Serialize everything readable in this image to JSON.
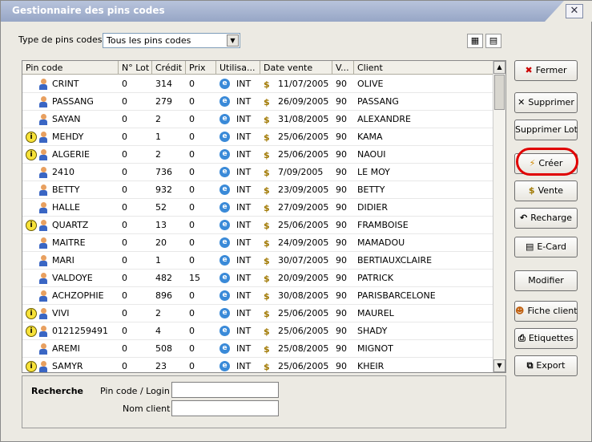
{
  "window": {
    "title": "Gestionnaire des pins codes",
    "close": "✕"
  },
  "filter": {
    "label": "Type de pins codes",
    "selected": "Tous les pins codes"
  },
  "grid": {
    "columns": [
      "Pin code",
      "N° Lot",
      "Crédit",
      "Prix",
      "Utilisa...",
      "Date vente",
      "V...",
      "Client"
    ],
    "rows": [
      {
        "info": false,
        "pin": "CRINT",
        "lot": "0",
        "credit": "314",
        "prix": "0",
        "util": "INT",
        "date": "11/07/2005",
        "v": "90",
        "client": "OLIVE"
      },
      {
        "info": false,
        "pin": "PASSANG",
        "lot": "0",
        "credit": "279",
        "prix": "0",
        "util": "INT",
        "date": "26/09/2005",
        "v": "90",
        "client": "PASSANG"
      },
      {
        "info": false,
        "pin": "SAYAN",
        "lot": "0",
        "credit": "2",
        "prix": "0",
        "util": "INT",
        "date": "31/08/2005",
        "v": "90",
        "client": "ALEXANDRE"
      },
      {
        "info": true,
        "pin": "MEHDY",
        "lot": "0",
        "credit": "1",
        "prix": "0",
        "util": "INT",
        "date": "25/06/2005",
        "v": "90",
        "client": "KAMA"
      },
      {
        "info": true,
        "pin": "ALGERIE",
        "lot": "0",
        "credit": "2",
        "prix": "0",
        "util": "INT",
        "date": "25/06/2005",
        "v": "90",
        "client": "NAOUI"
      },
      {
        "info": false,
        "pin": "2410",
        "lot": "0",
        "credit": "736",
        "prix": "0",
        "util": "INT",
        "date": "7/09/2005",
        "v": "90",
        "client": "LE MOY"
      },
      {
        "info": false,
        "pin": "BETTY",
        "lot": "0",
        "credit": "932",
        "prix": "0",
        "util": "INT",
        "date": "23/09/2005",
        "v": "90",
        "client": "BETTY"
      },
      {
        "info": false,
        "pin": "HALLE",
        "lot": "0",
        "credit": "52",
        "prix": "0",
        "util": "INT",
        "date": "27/09/2005",
        "v": "90",
        "client": "DIDIER"
      },
      {
        "info": true,
        "pin": "QUARTZ",
        "lot": "0",
        "credit": "13",
        "prix": "0",
        "util": "INT",
        "date": "25/06/2005",
        "v": "90",
        "client": "FRAMBOISE"
      },
      {
        "info": false,
        "pin": "MAITRE",
        "lot": "0",
        "credit": "20",
        "prix": "0",
        "util": "INT",
        "date": "24/09/2005",
        "v": "90",
        "client": "MAMADOU"
      },
      {
        "info": false,
        "pin": "MARI",
        "lot": "0",
        "credit": "1",
        "prix": "0",
        "util": "INT",
        "date": "30/07/2005",
        "v": "90",
        "client": "BERTIAUXCLAIRE"
      },
      {
        "info": false,
        "pin": "VALDOYE",
        "lot": "0",
        "credit": "482",
        "prix": "15",
        "util": "INT",
        "date": "20/09/2005",
        "v": "90",
        "client": "PATRICK"
      },
      {
        "info": false,
        "pin": "ACHZOPHIE",
        "lot": "0",
        "credit": "896",
        "prix": "0",
        "util": "INT",
        "date": "30/08/2005",
        "v": "90",
        "client": "PARISBARCELONE"
      },
      {
        "info": true,
        "pin": "VIVI",
        "lot": "0",
        "credit": "2",
        "prix": "0",
        "util": "INT",
        "date": "25/06/2005",
        "v": "90",
        "client": "MAUREL"
      },
      {
        "info": true,
        "pin": "0121259491",
        "lot": "0",
        "credit": "4",
        "prix": "0",
        "util": "INT",
        "date": "25/06/2005",
        "v": "90",
        "client": "SHADY"
      },
      {
        "info": false,
        "pin": "AREMI",
        "lot": "0",
        "credit": "508",
        "prix": "0",
        "util": "INT",
        "date": "25/08/2005",
        "v": "90",
        "client": "MIGNOT"
      },
      {
        "info": true,
        "pin": "SAMYR",
        "lot": "0",
        "credit": "23",
        "prix": "0",
        "util": "INT",
        "date": "25/06/2005",
        "v": "90",
        "client": "KHEIR"
      }
    ]
  },
  "search": {
    "title": "Recherche",
    "pin_label": "Pin code / Login :",
    "name_label": "Nom client :",
    "pin_value": "",
    "name_value": ""
  },
  "buttons": {
    "fermer": "Fermer",
    "supprimer": "Supprimer",
    "supprimer_lot": "Supprimer Lot",
    "creer": "Créer",
    "vente": "Vente",
    "recharge": "Recharge",
    "ecard": "E-Card",
    "modifier": "Modifier",
    "fiche": "Fiche client",
    "etiquettes": "Etiquettes",
    "export": "Export"
  }
}
